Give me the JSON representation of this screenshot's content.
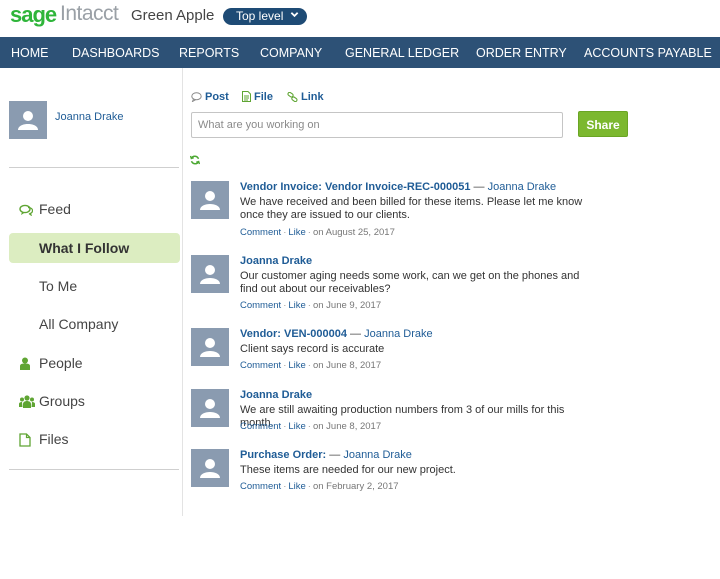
{
  "brand": {
    "sage": "sage",
    "intacct": "Intacct",
    "company": "Green Apple",
    "level": "Top level"
  },
  "nav": [
    "HOME",
    "DASHBOARDS",
    "REPORTS",
    "COMPANY",
    "GENERAL LEDGER",
    "ORDER ENTRY",
    "ACCOUNTS PAYABLE"
  ],
  "user": {
    "name": "Joanna Drake"
  },
  "sidebar": {
    "items": [
      {
        "label": "Feed",
        "icon": "feed-icon"
      },
      {
        "label": "What I Follow",
        "active": true
      },
      {
        "label": "To Me"
      },
      {
        "label": "All Company"
      },
      {
        "label": "People",
        "icon": "person-icon"
      },
      {
        "label": "Groups",
        "icon": "groups-icon"
      },
      {
        "label": "Files",
        "icon": "file-icon"
      }
    ]
  },
  "composer": {
    "tabs": [
      {
        "label": "Post",
        "icon": "speech-bubble-icon"
      },
      {
        "label": "File",
        "icon": "document-icon"
      },
      {
        "label": "Link",
        "icon": "link-icon"
      }
    ],
    "placeholder": "What are you working on",
    "share_label": "Share"
  },
  "feed": [
    {
      "title": "Vendor Invoice: Vendor Invoice-REC-000051",
      "sep": " — ",
      "user": "Joanna Drake",
      "body": "We have received and been billed for these items. Please let me know once they are issued to our clients.",
      "comment": "Comment",
      "like": "Like",
      "date": "on August 25, 2017"
    },
    {
      "title": "Joanna Drake",
      "sep": "",
      "user": "",
      "body": "Our customer aging needs some work, can we get on the phones and find out about our receivables?",
      "comment": "Comment",
      "like": "Like",
      "date": "on June 9, 2017"
    },
    {
      "title": "Vendor: VEN-000004",
      "sep": " — ",
      "user": "Joanna Drake",
      "body": "Client says record is accurate",
      "comment": "Comment",
      "like": "Like",
      "date": "on June 8, 2017"
    },
    {
      "title": "Joanna Drake",
      "sep": "",
      "user": "",
      "body": "We are still awaiting production numbers from 3 of our mills for this month.",
      "comment": "Comment",
      "like": "Like",
      "date": "on June 8, 2017"
    },
    {
      "title": "Purchase Order:",
      "sep": " — ",
      "user": "Joanna Drake",
      "body": "These items are needed for our new project.",
      "comment": "Comment",
      "like": "Like",
      "date": "on February 2, 2017"
    }
  ],
  "colors": {
    "nav_bg": "#2d5176",
    "brand_green": "#2fb53a",
    "link_blue": "#1f5c96",
    "share_green": "#7cb82f",
    "active_bg": "#dcedc1"
  }
}
